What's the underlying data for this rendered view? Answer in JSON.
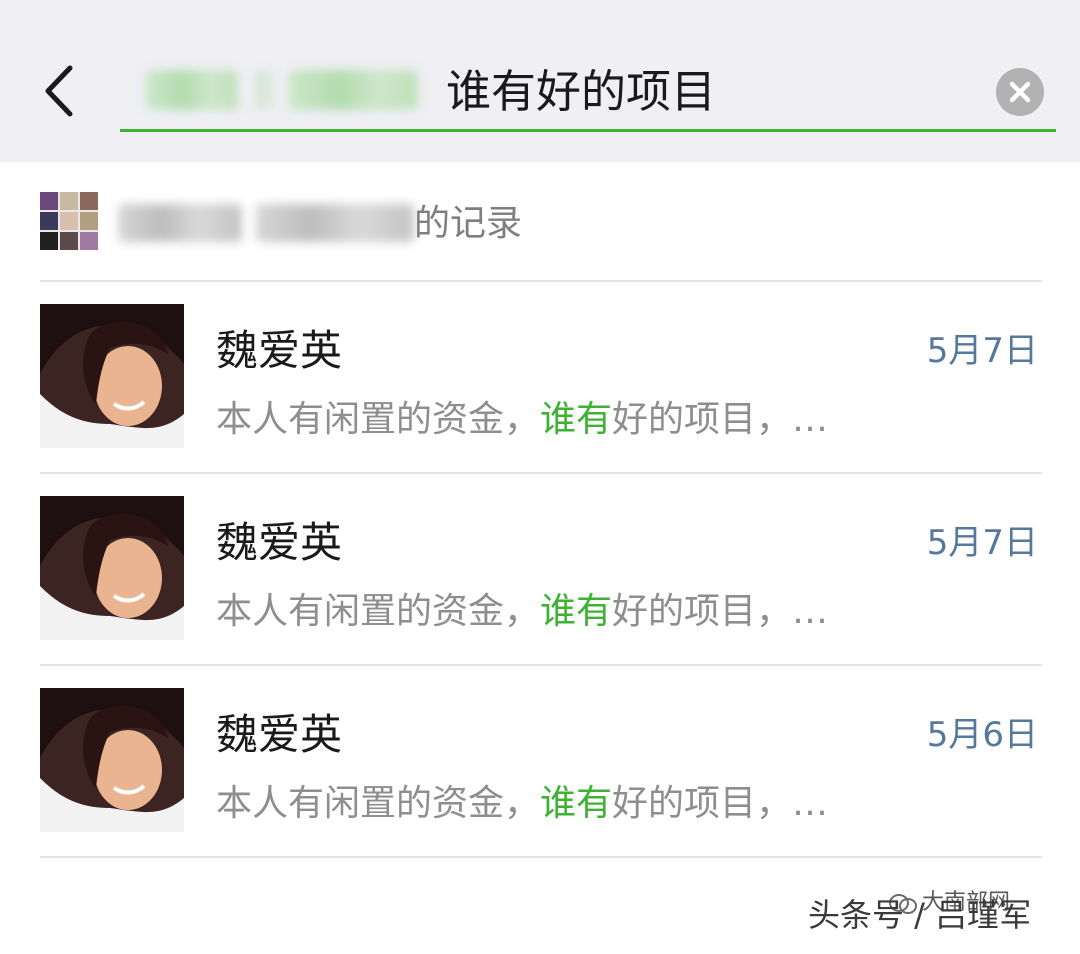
{
  "search": {
    "query": "谁有好的项目"
  },
  "group_record": {
    "suffix": "的记录"
  },
  "results": [
    {
      "name": "魏爱英",
      "date": "5月7日",
      "snippet_before": "本人有闲置的资金，",
      "snippet_highlight": "谁有",
      "snippet_after": "好的项目，…"
    },
    {
      "name": "魏爱英",
      "date": "5月7日",
      "snippet_before": "本人有闲置的资金，",
      "snippet_highlight": "谁有",
      "snippet_after": "好的项目，…"
    },
    {
      "name": "魏爱英",
      "date": "5月6日",
      "snippet_before": "本人有闲置的资金，",
      "snippet_highlight": "谁有",
      "snippet_after": "好的项目，…"
    }
  ],
  "watermark": {
    "main": "头条号 / 吕瑾军",
    "small": "大南部网"
  },
  "colors": {
    "accent_green": "#3fb234",
    "date_blue": "#55799b",
    "header_bg": "#efeff4",
    "snippet_gray": "#8e8e8e"
  },
  "icons": {
    "back": "chevron-left-icon",
    "clear": "clear-circle-icon"
  }
}
